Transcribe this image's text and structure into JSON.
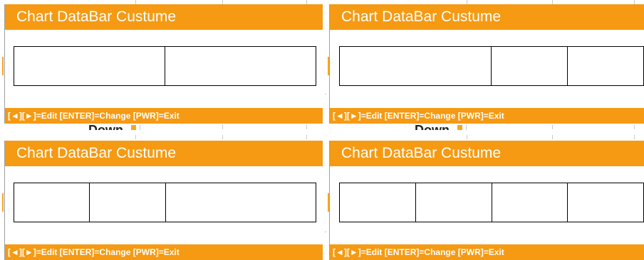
{
  "panels": [
    {
      "title": "Chart DataBar Custume",
      "footer": "[◄][►]=Edit [ENTER]=Change [PWR]=Exit",
      "cell_count": 2,
      "cell_weights": [
        1,
        1
      ]
    },
    {
      "title": "Chart DataBar Custume",
      "footer": "[◄][►]=Edit [ENTER]=Change [PWR]=Exit",
      "cell_count": 3,
      "cell_weights": [
        2,
        1,
        1
      ]
    },
    {
      "title": "Chart DataBar Custume",
      "footer": "[◄][►]=Edit [ENTER]=Change [PWR]=Exit",
      "cell_count": 3,
      "cell_weights": [
        1,
        1,
        2
      ]
    },
    {
      "title": "Chart DataBar Custume",
      "footer": "[◄][►]=Edit [ENTER]=Change [PWR]=Exit",
      "cell_count": 4,
      "cell_weights": [
        1,
        1,
        1,
        1
      ]
    }
  ],
  "background": {
    "partial_text": "Down"
  },
  "colors": {
    "accent": "#f59a12",
    "border": "#000000"
  }
}
